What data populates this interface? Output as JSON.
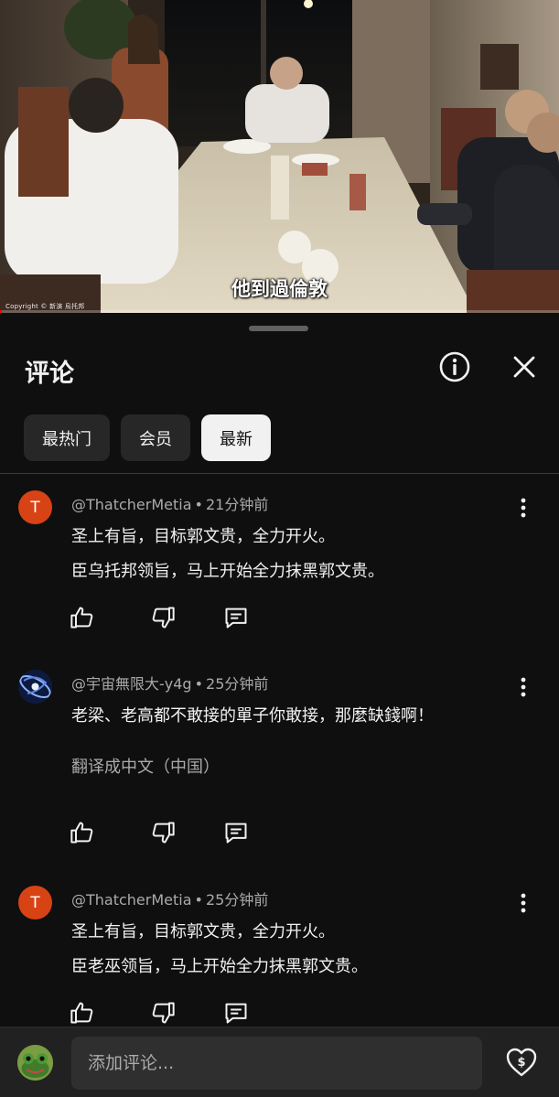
{
  "video": {
    "subtitle": "他到過倫敦",
    "copyright": "Copyright © 新演 烏托邦",
    "progress": 0.004
  },
  "panel": {
    "title": "评论",
    "info_icon": "info-icon",
    "close_icon": "close-icon"
  },
  "chips": [
    {
      "label": "最热门",
      "selected": false
    },
    {
      "label": "会员",
      "selected": false
    },
    {
      "label": "最新",
      "selected": true
    }
  ],
  "comments": [
    {
      "avatar_letter": "T",
      "author": "@ThatcherMetia",
      "time": "21分钟前",
      "lines": [
        "圣上有旨，目标郭文贵，全力开火。",
        "臣乌托邦领旨，马上开始全力抹黑郭文贵。"
      ]
    },
    {
      "avatar_letter": "",
      "author": "@宇宙無限大-y4g",
      "time": "25分钟前",
      "lines": [
        "老梁、老高都不敢接的單子你敢接，那麼缺錢啊！"
      ],
      "translate": "翻译成中文（中国）"
    },
    {
      "avatar_letter": "T",
      "author": "@ThatcherMetia",
      "time": "25分钟前",
      "lines": [
        "圣上有旨，目标郭文贵，全力开火。",
        "臣老巫领旨，马上开始全力抹黑郭文贵。"
      ]
    }
  ],
  "separator": "•",
  "input": {
    "placeholder": "添加评论..."
  },
  "icons": {
    "like": "thumbs-up-icon",
    "dislike": "thumbs-down-icon",
    "reply": "reply-icon",
    "more": "more-vertical-icon",
    "thanks": "super-thanks-icon"
  },
  "colors": {
    "background": "#0f0f0f",
    "chip": "#272727",
    "chip_selected": "#f1f1f1",
    "avatar_t": "#d84315",
    "progress": "#ff0000"
  }
}
